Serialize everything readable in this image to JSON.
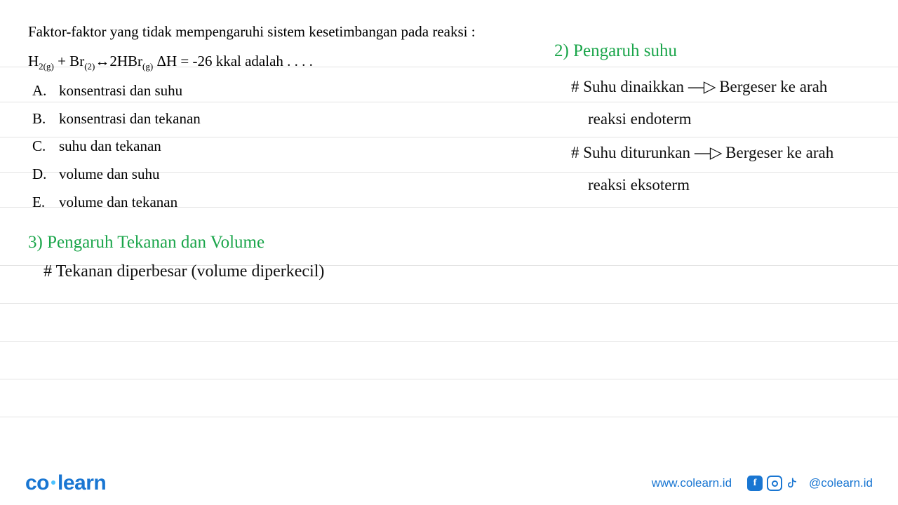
{
  "question": {
    "intro": "Faktor-faktor yang tidak mempengaruhi sistem kesetimbangan pada reaksi :",
    "equation_h2": "H",
    "equation_h2_sub": "2(g)",
    "equation_plus": " + Br",
    "equation_br_sub": "(2)",
    "equation_arrow": "↔2HBr",
    "equation_hbr_sub": "(g)",
    "equation_tail": "   ΔH = -26 kkal  adalah . . . .",
    "options": [
      {
        "letter": "A.",
        "text": "konsentrasi dan suhu"
      },
      {
        "letter": "B.",
        "text": "konsentrasi dan tekanan"
      },
      {
        "letter": "C.",
        "text": "suhu dan tekanan"
      },
      {
        "letter": "D.",
        "text": "volume dan suhu"
      },
      {
        "letter": "E.",
        "text": "volume dan tekanan"
      }
    ]
  },
  "notes_right": {
    "title": "2) Pengaruh  suhu",
    "line1a": "# Suhu dinaikkan ",
    "line1b": " Bergeser  ke  arah",
    "line2": "reaksi  endoterm",
    "line3a": "# Suhu  diturunkan ",
    "line3b": " Bergeser ke  arah",
    "line4": "reaksi  eksoterm"
  },
  "section3": {
    "title": "3) Pengaruh  Tekanan  dan  Volume",
    "line1": "# Tekanan  diperbesar  (volume  diperkecil)"
  },
  "footer": {
    "logo_a": "co",
    "logo_b": "learn",
    "url": "www.colearn.id",
    "handle": "@colearn.id"
  },
  "arrow_glyph": "—▷"
}
